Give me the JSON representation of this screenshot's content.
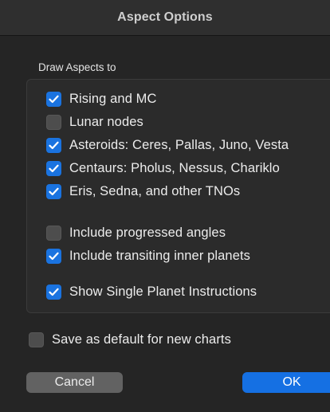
{
  "window": {
    "title": "Aspect Options"
  },
  "group": {
    "label": "Draw Aspects to"
  },
  "options": [
    {
      "label": "Rising and MC",
      "checked": true
    },
    {
      "label": "Lunar nodes",
      "checked": false
    },
    {
      "label": "Asteroids: Ceres, Pallas, Juno, Vesta",
      "checked": true
    },
    {
      "label": "Centaurs: Pholus, Nessus, Chariklo",
      "checked": true
    },
    {
      "label": "Eris, Sedna, and other TNOs",
      "checked": true
    },
    {
      "label": "Include progressed angles",
      "checked": false
    },
    {
      "label": "Include transiting inner planets",
      "checked": true
    },
    {
      "label": "Show Single Planet Instructions",
      "checked": true
    }
  ],
  "save_default": {
    "label": "Save as default for new charts",
    "checked": false
  },
  "buttons": {
    "cancel": "Cancel",
    "ok": "OK"
  },
  "colors": {
    "accent": "#1a73e0",
    "background": "#252525"
  }
}
